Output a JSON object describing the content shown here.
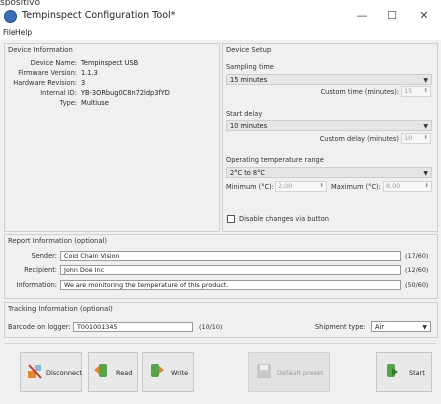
{
  "top_text": "spositivo",
  "window": {
    "title": "Tempinspect Configuration Tool*",
    "minimize": "—",
    "maximize": "☐",
    "close": "✕"
  },
  "menu": {
    "file": "File",
    "help": "Help"
  },
  "device_info": {
    "title": "Device Information",
    "rows": [
      {
        "label": "Device Name:",
        "value": "Tempinspect USB"
      },
      {
        "label": "Firmware Version:",
        "value": "1.1.3"
      },
      {
        "label": "Hardware Revision:",
        "value": "3"
      },
      {
        "label": "Internal ID:",
        "value": "YB-3ORbug0C8n72ldp3fYD"
      },
      {
        "label": "Type:",
        "value": "Multiuse"
      }
    ]
  },
  "device_setup": {
    "title": "Device Setup",
    "sampling_label": "Sampling time",
    "sampling_value": "15 minutes",
    "custom_time_label": "Custom time (minutes):",
    "custom_time_value": "15",
    "start_delay_label": "Start delay",
    "start_delay_value": "10 minutes",
    "custom_delay_label": "Custom delay (minutes)",
    "custom_delay_value": "10",
    "temp_range_label": "Operating temperature range",
    "temp_range_value": "2°C to 8°C",
    "min_label": "Minimum (°C):",
    "min_value": "2,00",
    "max_label": "Maximum (°C):",
    "max_value": "8,00",
    "disable_label": "Disable changes via button"
  },
  "report": {
    "title": "Report Information (optional)",
    "sender_label": "Sender:",
    "sender_value": "Cold Chain Vision",
    "sender_count": "(17/60)",
    "recipient_label": "Recipient:",
    "recipient_value": "John Doe Inc",
    "recipient_count": "(12/60)",
    "information_label": "Information:",
    "information_value": "We are monitoring the temperature of this product.",
    "information_count": "(50/60)"
  },
  "tracking": {
    "title": "Tracking Information (optional)",
    "barcode_label": "Barcode on logger:",
    "barcode_value": "T001001345",
    "barcode_count": "(10/10)",
    "shipment_label": "Shipment type:",
    "shipment_value": "Air"
  },
  "buttons": {
    "disconnect": "Disconnect",
    "read": "Read",
    "write": "Write",
    "default_preset": "Default preset",
    "start": "Start"
  },
  "icons": {
    "app": "thermometer-app-icon",
    "disconnect": "disconnect-plug-icon",
    "read": "read-logger-icon",
    "write": "write-logger-icon",
    "default_preset": "save-disk-icon",
    "start": "start-logger-icon"
  }
}
